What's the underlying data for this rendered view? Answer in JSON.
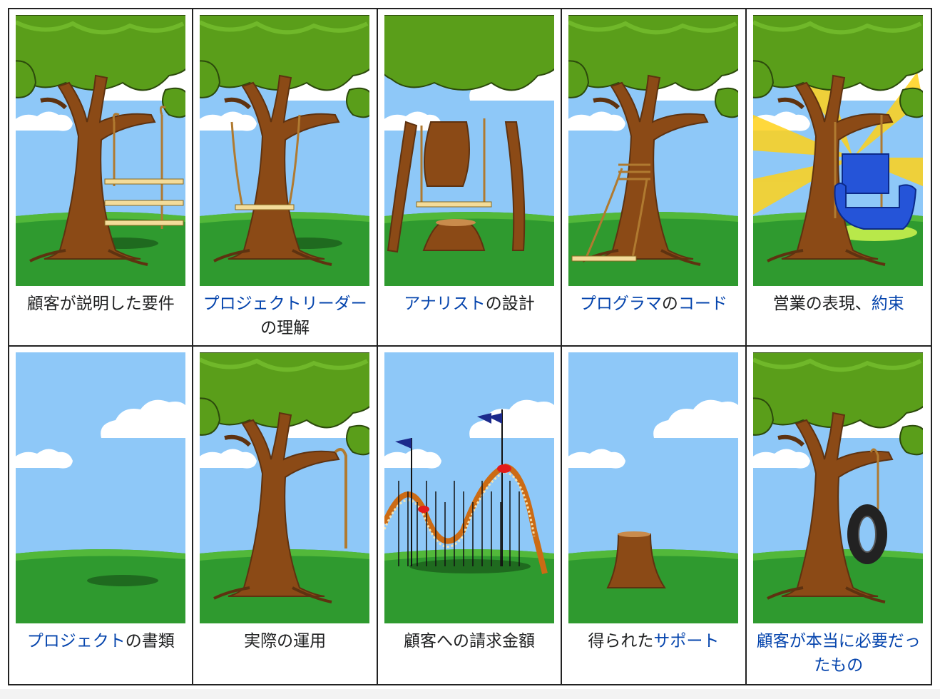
{
  "colors": {
    "sky": "#8ec8f8",
    "grass": "#2f9a2f",
    "grass_light": "#52b83a",
    "trunk": "#8b4a16",
    "trunk_dark": "#5e3210",
    "leaves": "#5a9e1a",
    "leaves_light": "#70b82a",
    "cloud": "#ffffff",
    "link": "#0645ad",
    "text": "#202122",
    "plank": "#f3dc9a",
    "rope": "#b07a30",
    "chair": "#2554d8",
    "tire": "#222222",
    "flag": "#1c2a8c",
    "coaster": "#cc6b14",
    "sun": "#ffd21a"
  },
  "panels": [
    {
      "scene": "swing-three-seats",
      "caption": [
        {
          "text": "顧客が説明した要件",
          "link": false
        }
      ]
    },
    {
      "scene": "swing-trunk-through",
      "caption": [
        {
          "text": "プロジェクトリーダー",
          "link": true
        },
        {
          "text": "の理解",
          "link": false
        }
      ]
    },
    {
      "scene": "swing-cut-tree",
      "caption": [
        {
          "text": "アナリスト",
          "link": true
        },
        {
          "text": "の設計",
          "link": false
        }
      ]
    },
    {
      "scene": "swing-tied-trunk",
      "caption": [
        {
          "text": "プログラマ",
          "link": true
        },
        {
          "text": "の",
          "link": false
        },
        {
          "text": "コード",
          "link": true
        }
      ]
    },
    {
      "scene": "armchair",
      "caption": [
        {
          "text": "営業の表現、",
          "link": false
        },
        {
          "text": "約束",
          "link": true
        }
      ]
    },
    {
      "scene": "empty",
      "caption": [
        {
          "text": "プロジェクト",
          "link": true
        },
        {
          "text": "の書類",
          "link": false
        }
      ]
    },
    {
      "scene": "rope-only",
      "caption": [
        {
          "text": "実際の運用",
          "link": false
        }
      ]
    },
    {
      "scene": "rollercoaster",
      "caption": [
        {
          "text": "顧客への請求金額",
          "link": false
        }
      ]
    },
    {
      "scene": "stump",
      "caption": [
        {
          "text": "得られた",
          "link": false
        },
        {
          "text": "サポート",
          "link": true
        }
      ]
    },
    {
      "scene": "tire-swing",
      "caption": [
        {
          "text": "顧客が本当に必要だったもの",
          "link": true
        }
      ]
    }
  ]
}
